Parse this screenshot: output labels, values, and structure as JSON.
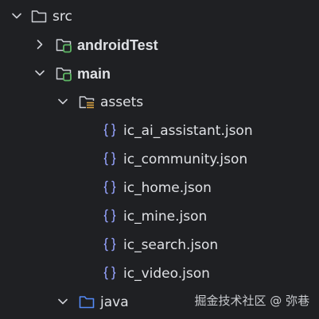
{
  "tree": {
    "nodes": [
      {
        "label": "src",
        "type": "folder",
        "expanded": true,
        "bold": false
      },
      {
        "label": "androidTest",
        "type": "source-root-folder",
        "expanded": false,
        "bold": true
      },
      {
        "label": "main",
        "type": "source-root-folder",
        "expanded": true,
        "bold": true
      },
      {
        "label": "assets",
        "type": "resources-folder",
        "expanded": true,
        "bold": false
      },
      {
        "label": "ic_ai_assistant.json",
        "type": "json-file",
        "bold": false
      },
      {
        "label": "ic_community.json",
        "type": "json-file",
        "bold": false
      },
      {
        "label": "ic_home.json",
        "type": "json-file",
        "bold": false
      },
      {
        "label": "ic_mine.json",
        "type": "json-file",
        "bold": false
      },
      {
        "label": "ic_search.json",
        "type": "json-file",
        "bold": false
      },
      {
        "label": "ic_video.json",
        "type": "json-file",
        "bold": false
      },
      {
        "label": "java",
        "type": "source-folder",
        "expanded": true,
        "bold": false
      }
    ]
  },
  "watermark": {
    "text": "掘金技术社区 @ 弥巷"
  },
  "colors": {
    "background": "#1f2023",
    "text": "#dfe1e5",
    "folder_outline": "#ced0d6",
    "source_root_badge": "#5fb865",
    "resources_badge": "#d9a343",
    "java_folder": "#548af7",
    "json_brace": "#8f9cf2"
  },
  "icons": {
    "expanded_arrow": "chevron-down-icon",
    "collapsed_arrow": "chevron-right-icon",
    "folder": "folder-icon",
    "json": "json-file-icon"
  }
}
